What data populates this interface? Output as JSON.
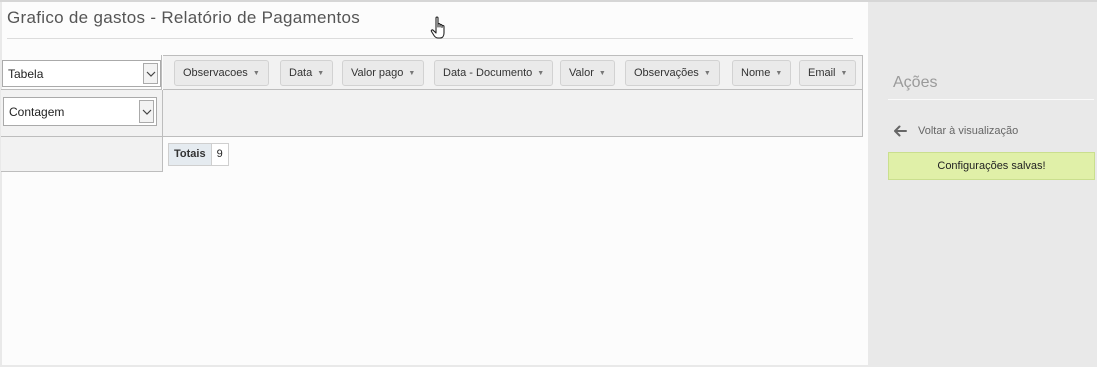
{
  "page": {
    "title": "Grafico de gastos - Relatório de Pagamentos"
  },
  "pivot": {
    "renderer_select": "Tabela",
    "aggregator_select": "Contagem",
    "fields": [
      {
        "label": "Observacoes",
        "name": "field-observacoes"
      },
      {
        "label": "Data",
        "name": "field-data"
      },
      {
        "label": "Valor pago",
        "name": "field-valor-pago"
      },
      {
        "label": "Data - Documento",
        "name": "field-data-documento"
      },
      {
        "label": "Valor",
        "name": "field-valor"
      },
      {
        "label": "Observações",
        "name": "field-observacoes-2"
      },
      {
        "label": "Nome",
        "name": "field-nome"
      },
      {
        "label": "Email",
        "name": "field-email"
      }
    ],
    "dropdown_caret": "▼",
    "totals_label": "Totais",
    "totals_value": "9"
  },
  "sidebar": {
    "title": "Ações",
    "back_link": "Voltar à visualização",
    "status_message": "Configurações salvas!"
  },
  "colors": {
    "success_bg": "#e0f0a8",
    "sidebar_bg": "#e9e9e9"
  },
  "icons": {
    "back": "arrow-left-icon",
    "cursor": "hand-pointer-icon",
    "select_arrow": "chevron-down-icon"
  }
}
